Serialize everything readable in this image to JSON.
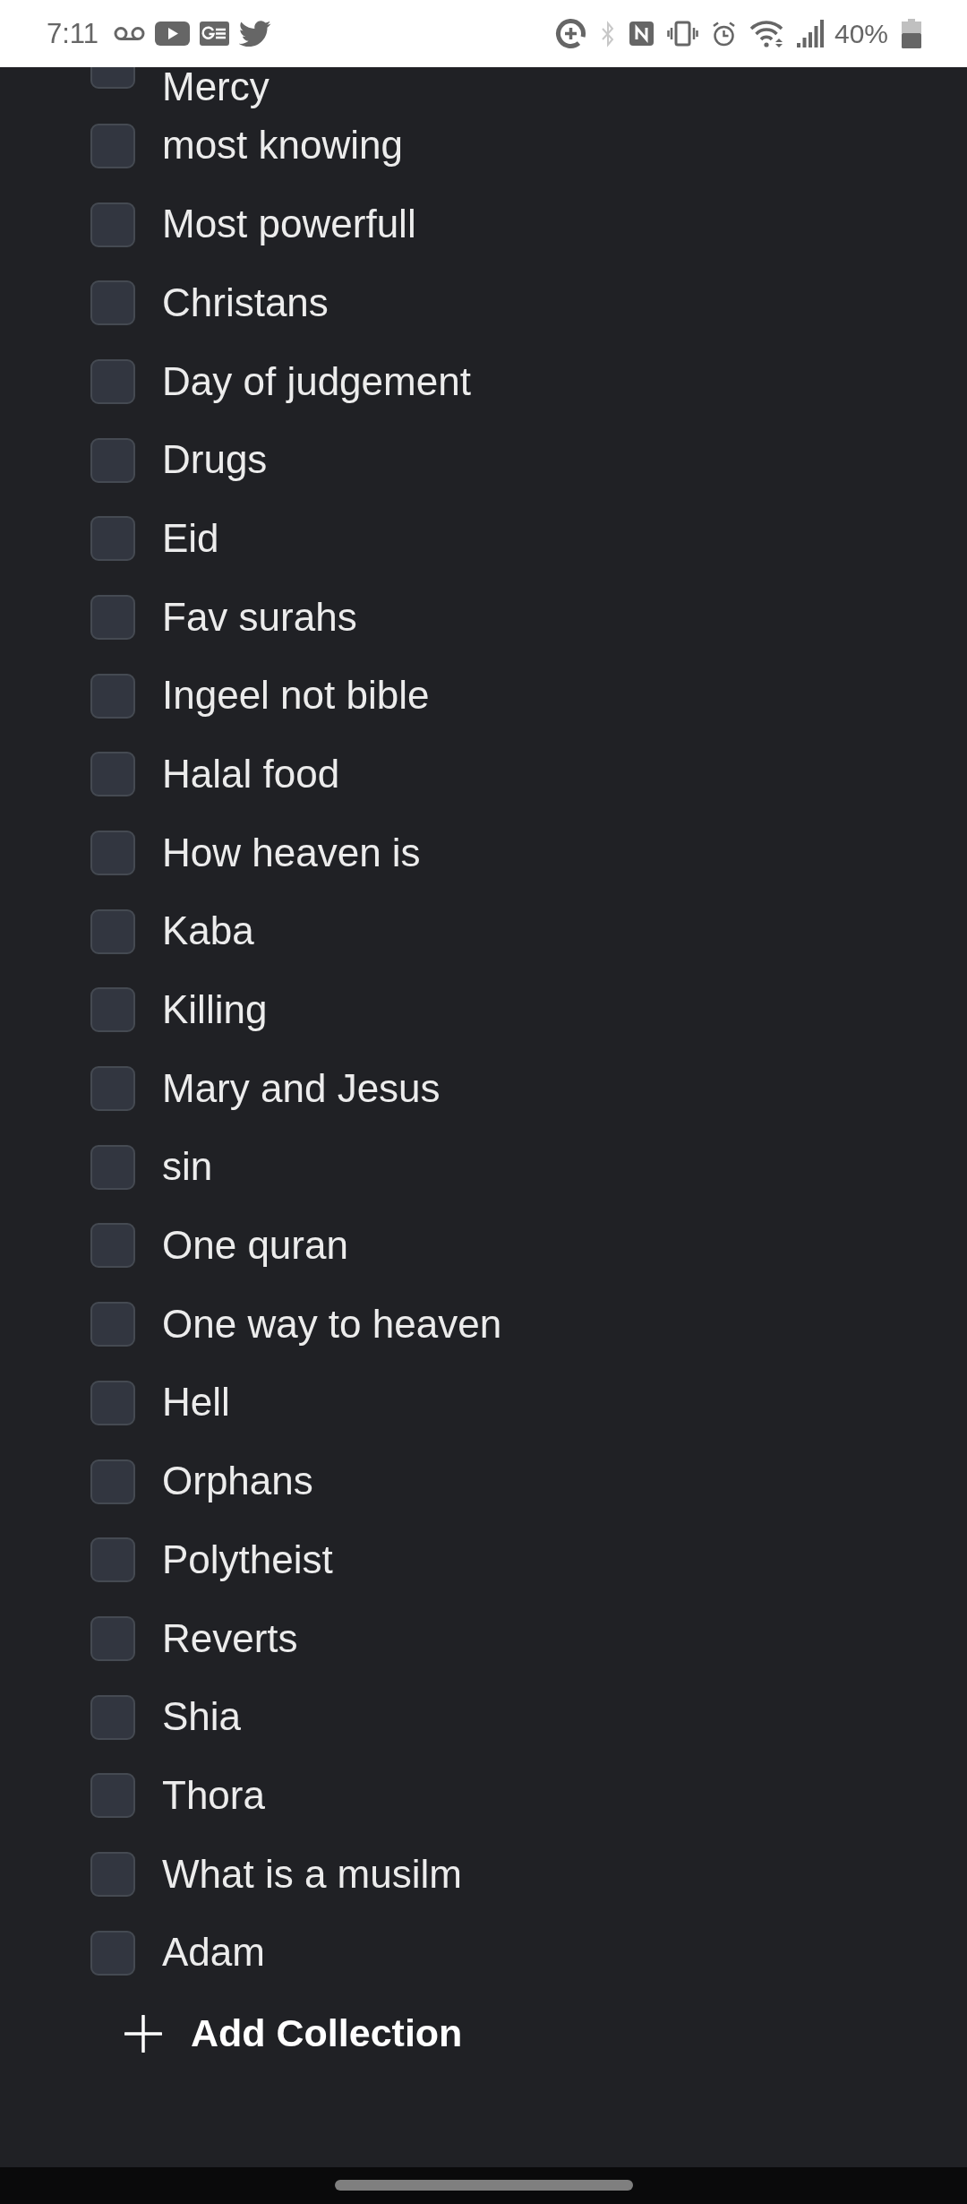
{
  "status_bar": {
    "time": "7:11",
    "battery": "40%"
  },
  "collections": [
    {
      "label": "Mercy",
      "checked": false
    },
    {
      "label": "most knowing",
      "checked": false
    },
    {
      "label": "Most powerfull",
      "checked": false
    },
    {
      "label": "Christans",
      "checked": false
    },
    {
      "label": "Day of judgement",
      "checked": false
    },
    {
      "label": "Drugs",
      "checked": false
    },
    {
      "label": "Eid",
      "checked": false
    },
    {
      "label": "Fav surahs",
      "checked": false
    },
    {
      "label": "Ingeel not bible",
      "checked": false
    },
    {
      "label": "Halal food",
      "checked": false
    },
    {
      "label": "How heaven is",
      "checked": false
    },
    {
      "label": "Kaba",
      "checked": false
    },
    {
      "label": "Killing",
      "checked": false
    },
    {
      "label": "Mary and Jesus",
      "checked": false
    },
    {
      "label": "sin",
      "checked": false
    },
    {
      "label": "One quran",
      "checked": false
    },
    {
      "label": "One way to heaven",
      "checked": false
    },
    {
      "label": "Hell",
      "checked": false
    },
    {
      "label": "Orphans",
      "checked": false
    },
    {
      "label": "Polytheist",
      "checked": false
    },
    {
      "label": "Reverts",
      "checked": false
    },
    {
      "label": "Shia",
      "checked": false
    },
    {
      "label": "Thora",
      "checked": false
    },
    {
      "label": "What is a musilm",
      "checked": false
    },
    {
      "label": "Adam",
      "checked": false
    }
  ],
  "add_button": {
    "label": "Add Collection"
  }
}
